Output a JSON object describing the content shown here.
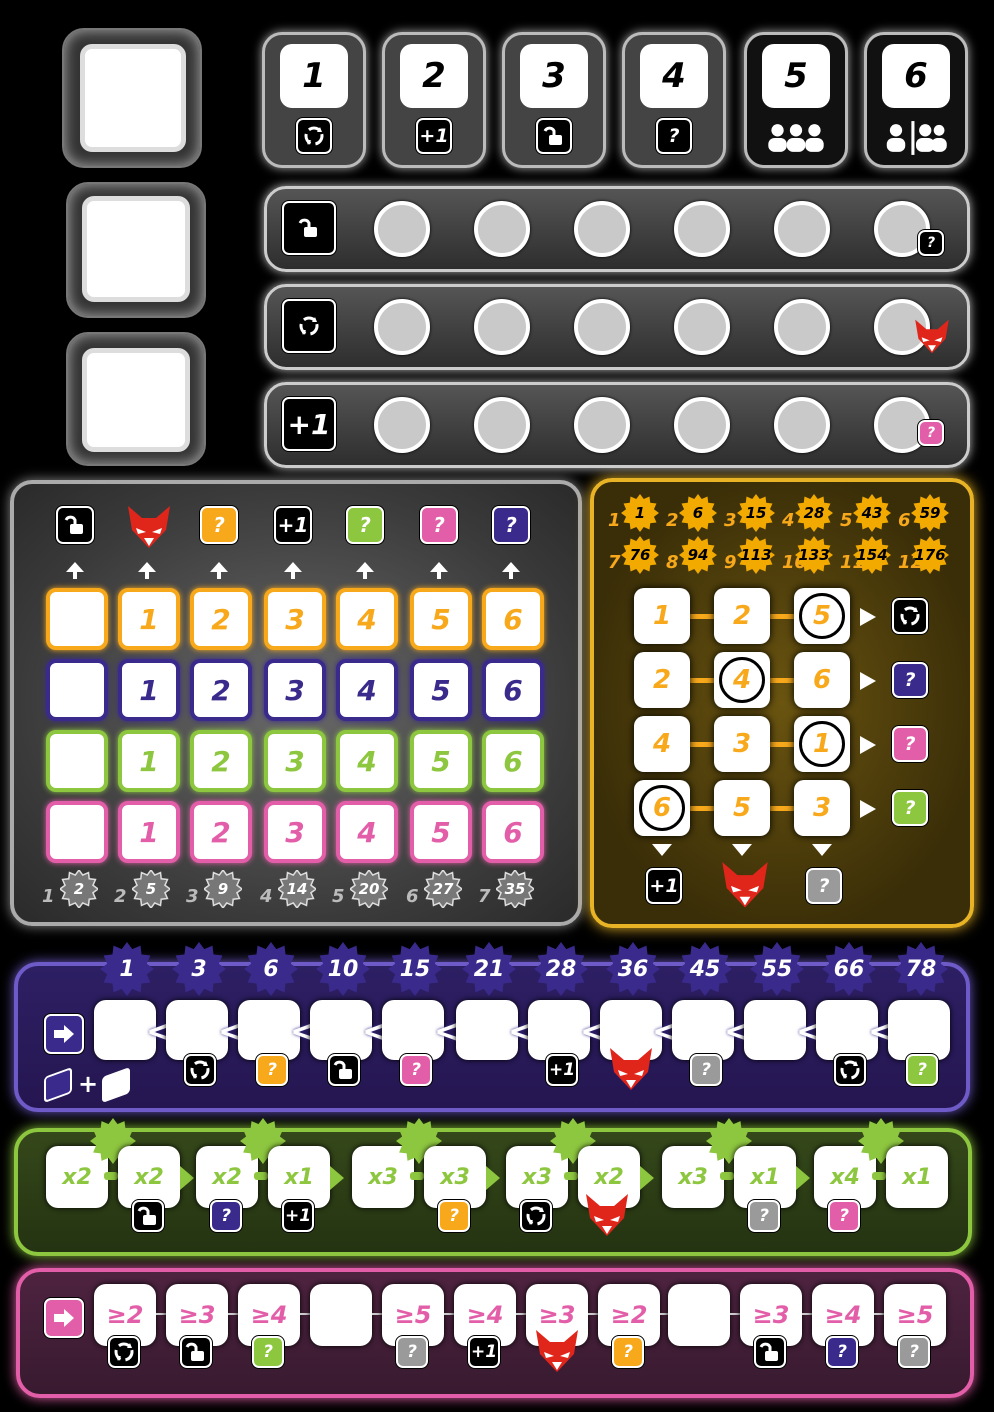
{
  "colors": {
    "orange": "#f7a81b",
    "blue": "#3a2a8c",
    "green": "#8dc63f",
    "pink": "#e35ea8",
    "gray": "#9a9a9a",
    "red_fox": "#e0251b",
    "yellow_panel": "#e8b426"
  },
  "top": {
    "dice_numbers": [
      "1",
      "2",
      "3",
      "4",
      "5",
      "6"
    ],
    "dice_icons": [
      "reroll-icon",
      "plus-one-icon",
      "unlock-icon",
      "question-icon",
      "three-people-icon",
      "split-people-icon"
    ],
    "tracks": [
      {
        "icon": "unlock-icon",
        "end_bonus": "?"
      },
      {
        "icon": "reroll-icon",
        "end_bonus": "fox-icon"
      },
      {
        "icon": "plus-one-icon",
        "end_bonus": "?"
      }
    ],
    "plus_one": "+1",
    "q": "?"
  },
  "grid": {
    "header_icons": [
      "unlock-icon",
      "fox-icon",
      "orange-question",
      "plus-one-icon",
      "green-question",
      "pink-question",
      "blue-question"
    ],
    "header_labels": [
      "",
      "",
      "?",
      "+1",
      "?",
      "?",
      "?"
    ],
    "row_numbers": [
      "1",
      "2",
      "3",
      "4",
      "5",
      "6"
    ],
    "scores": [
      {
        "n": "1",
        "v": "2"
      },
      {
        "n": "2",
        "v": "5"
      },
      {
        "n": "3",
        "v": "9"
      },
      {
        "n": "4",
        "v": "14"
      },
      {
        "n": "5",
        "v": "20"
      },
      {
        "n": "6",
        "v": "27"
      },
      {
        "n": "7",
        "v": "35"
      }
    ]
  },
  "yellow": {
    "scores": [
      {
        "n": "1",
        "v": "1"
      },
      {
        "n": "2",
        "v": "6"
      },
      {
        "n": "3",
        "v": "15"
      },
      {
        "n": "4",
        "v": "28"
      },
      {
        "n": "5",
        "v": "43"
      },
      {
        "n": "6",
        "v": "59"
      },
      {
        "n": "7",
        "v": "76"
      },
      {
        "n": "8",
        "v": "94"
      },
      {
        "n": "9",
        "v": "113"
      },
      {
        "n": "10",
        "v": "133"
      },
      {
        "n": "11",
        "v": "154"
      },
      {
        "n": "12",
        "v": "176"
      }
    ],
    "rows": [
      [
        "1",
        "2",
        "5"
      ],
      [
        "2",
        "4",
        "6"
      ],
      [
        "4",
        "3",
        "1"
      ],
      [
        "6",
        "5",
        "3"
      ]
    ],
    "row_bonus": [
      "reroll-icon",
      "blue-question",
      "pink-question",
      "green-question"
    ],
    "col_bonus": [
      "+1",
      "fox-icon",
      "?"
    ]
  },
  "blue_track": {
    "stars": [
      "1",
      "3",
      "6",
      "10",
      "15",
      "21",
      "28",
      "36",
      "45",
      "55",
      "66",
      "78"
    ],
    "sep": "<",
    "bonuses": [
      "",
      "reroll-icon",
      "orange-question",
      "unlock-icon",
      "pink-question",
      "",
      "plus-one-icon",
      "fox-icon",
      "gray-question",
      "",
      "reroll-icon",
      "green-question"
    ],
    "plus": "+"
  },
  "green_track": {
    "mult": [
      "x2",
      "x2",
      "x2",
      "x1",
      "x3",
      "x3",
      "x3",
      "x2",
      "x3",
      "x1",
      "x4",
      "x1"
    ],
    "bonuses": [
      "",
      "unlock-icon",
      "blue-question",
      "plus-one-icon",
      "",
      "orange-question",
      "reroll-icon",
      "fox-icon",
      "",
      "gray-question",
      "pink-question",
      ""
    ]
  },
  "pink_track": {
    "req": [
      "≥2",
      "≥3",
      "≥4",
      "",
      "≥5",
      "≥4",
      "≥3",
      "≥2",
      "",
      "≥3",
      "≥4",
      "≥5"
    ],
    "bonuses": [
      "reroll-icon",
      "unlock-icon",
      "green-question",
      "",
      "gray-question",
      "plus-one-icon",
      "fox-icon",
      "orange-question",
      "",
      "unlock-icon",
      "blue-question",
      "gray-question"
    ]
  }
}
